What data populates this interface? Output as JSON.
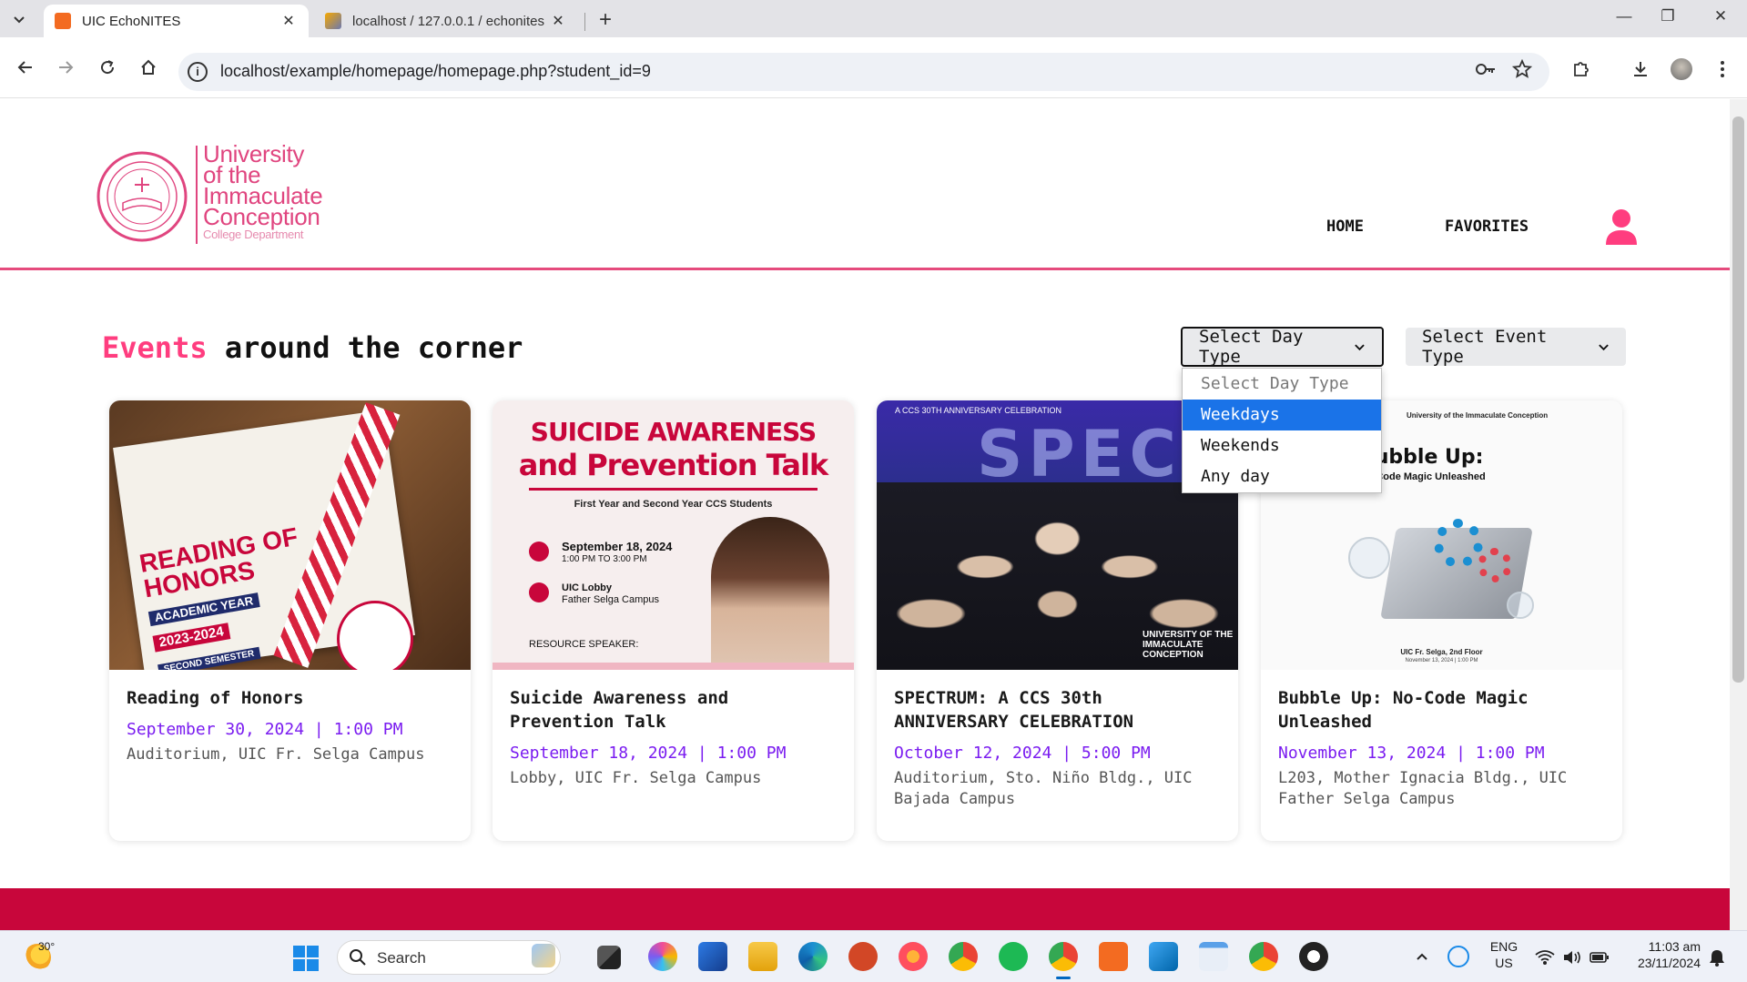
{
  "browser": {
    "tabs": [
      {
        "title": "UIC EchoNITES",
        "active": true,
        "close": "✕"
      },
      {
        "title": "localhost / 127.0.0.1 / echonites",
        "active": false,
        "close": "✕"
      }
    ],
    "new_tab": "+",
    "address": "localhost/example/homepage/homepage.php?student_id=9",
    "window_controls": [
      "—",
      "❐",
      "✕"
    ]
  },
  "site": {
    "logo": {
      "line1": "University",
      "line2": "of the",
      "line3": "Immaculate",
      "line4": "Conception",
      "line5": "College Department"
    },
    "nav": {
      "home": "HOME",
      "favorites": "FAVORITES"
    },
    "colors": {
      "accent": "#ff3d7f",
      "brand_red": "#c8063b",
      "date_purple": "#7a1cf0",
      "header_line": "#e54b7d"
    }
  },
  "events_section": {
    "title_highlight": "Events",
    "title_rest": "around the corner",
    "day_type_select": {
      "label": "Select Day Type",
      "options": [
        "Select Day Type",
        "Weekdays",
        "Weekends",
        "Any day"
      ],
      "highlighted": "Weekdays"
    },
    "event_type_select": {
      "label": "Select Event Type"
    }
  },
  "events": [
    {
      "title": "Reading of Honors",
      "date": "September 30, 2024 | 1:00 PM",
      "location": "Auditorium, UIC Fr. Selga Campus",
      "poster": {
        "line1": "READING OF",
        "line2": "HONORS",
        "line3": "ACADEMIC YEAR",
        "line4": "2023-2024",
        "line5": "SECOND SEMESTER"
      }
    },
    {
      "title": "Suicide Awareness and Prevention Talk",
      "date": "September 18, 2024 | 1:00 PM",
      "location": "Lobby, UIC Fr. Selga Campus",
      "poster": {
        "line1": "SUICIDE AWARENESS",
        "line2": "and Prevention Talk",
        "line3": "First Year and Second Year CCS Students",
        "line4": "September 18, 2024",
        "line5": "1:00 PM TO 3:00 PM",
        "line6": "UIC Lobby",
        "line7": "Father Selga Campus",
        "line8": "RESOURCE SPEAKER:"
      }
    },
    {
      "title": "SPECTRUM: A CCS 30th ANNIVERSARY CELEBRATION",
      "date": "October 12, 2024 | 5:00 PM",
      "location": "Auditorium, Sto. Niño Bldg., UIC Bajada Campus",
      "poster": {
        "line1": "A CCS 30TH ANNIVERSARY CELEBRATION",
        "line2": "SPEC",
        "line3": "UNIVERSITY OF THE IMMACULATE CONCEPTION"
      }
    },
    {
      "title": "Bubble Up: No-Code Magic Unleashed",
      "date": "November 13, 2024 | 1:00 PM",
      "location": "L203, Mother Ignacia Bldg., UIC Father Selga Campus",
      "poster": {
        "line1": "University of the Immaculate Conception",
        "line2": "Bubble Up:",
        "line3": "No-Code Magic Unleashed",
        "line4": "UIC Fr. Selga, 2nd Floor",
        "line5": "November 13, 2024 | 1:00 PM"
      }
    }
  ],
  "taskbar": {
    "weather": "30°",
    "search": "Search",
    "lang1": "ENG",
    "lang2": "US",
    "time": "11:03 am",
    "date": "23/11/2024"
  }
}
